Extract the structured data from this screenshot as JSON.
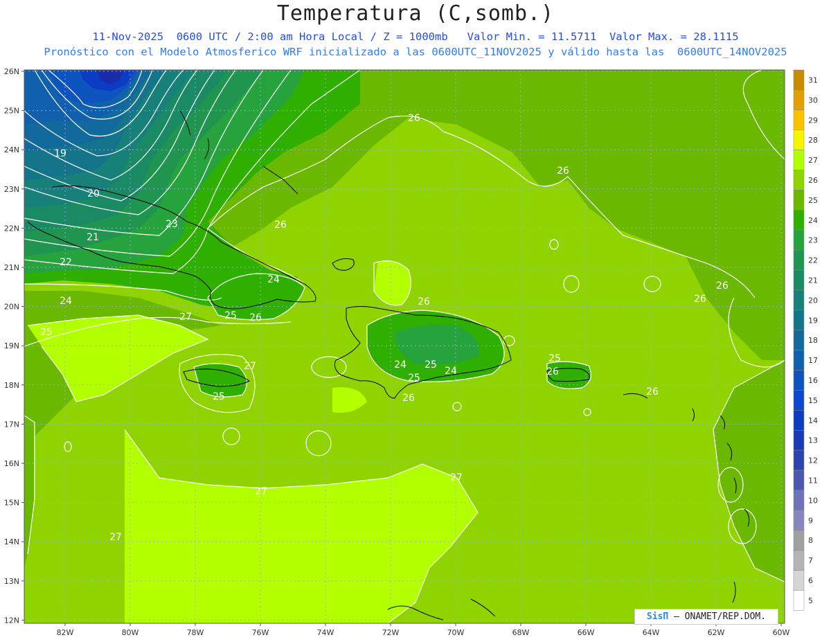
{
  "header": {
    "title": "Temperatura (C,somb.)",
    "line1": "11-Nov-2025  0600 UTC / 2:00 am Hora Local / Z = 1000mb   Valor Min. = 11.5711  Valor Max. = 28.1115",
    "line2": "Pronóstico con el Modelo Atmosferico WRF inicializado a las 0600UTC_11NOV2025 y válido hasta las  0600UTC_14NOV2025"
  },
  "axes": {
    "lat_labels": [
      "26N",
      "25N",
      "24N",
      "23N",
      "22N",
      "21N",
      "20N",
      "19N",
      "18N",
      "17N",
      "16N",
      "15N",
      "14N",
      "13N",
      "12N"
    ],
    "lon_labels": [
      "82W",
      "80W",
      "78W",
      "76W",
      "74W",
      "72W",
      "70W",
      "68W",
      "66W",
      "64W",
      "62W",
      "60W"
    ]
  },
  "colorbar": {
    "labels": [
      "31",
      "30",
      "29",
      "28",
      "27",
      "26",
      "25",
      "24",
      "23",
      "22",
      "21",
      "20",
      "19",
      "18",
      "17",
      "16",
      "15",
      "14",
      "13",
      "12",
      "11",
      "10",
      "9",
      "8",
      "7",
      "6",
      "5"
    ],
    "colors": [
      "#c78a00",
      "#e0a000",
      "#ffc000",
      "#f5f500",
      "#b2ff00",
      "#8fd400",
      "#6ab800",
      "#2fb000",
      "#26a33c",
      "#1f9550",
      "#1a8a64",
      "#178078",
      "#14758a",
      "#126a9c",
      "#1060ad",
      "#0e54be",
      "#0c48cf",
      "#0a3cc4",
      "#1a3cb8",
      "#2c44ad",
      "#4a58b0",
      "#6e72b8",
      "#8a86bc",
      "#a0a0a0",
      "#b4b4b4",
      "#d6d6d6",
      "#ffffff"
    ]
  },
  "contour_labels": [
    "26",
    "26",
    "26",
    "26",
    "26",
    "26",
    "19",
    "20",
    "23",
    "21",
    "22",
    "24",
    "25",
    "25",
    "26",
    "24",
    "27",
    "27",
    "26",
    "25",
    "24",
    "25",
    "25",
    "24",
    "26",
    "25",
    "26",
    "27",
    "27",
    "27"
  ],
  "credit": {
    "brand": "SisΠ",
    "text": " – ONAMET/REP.DOM."
  }
}
